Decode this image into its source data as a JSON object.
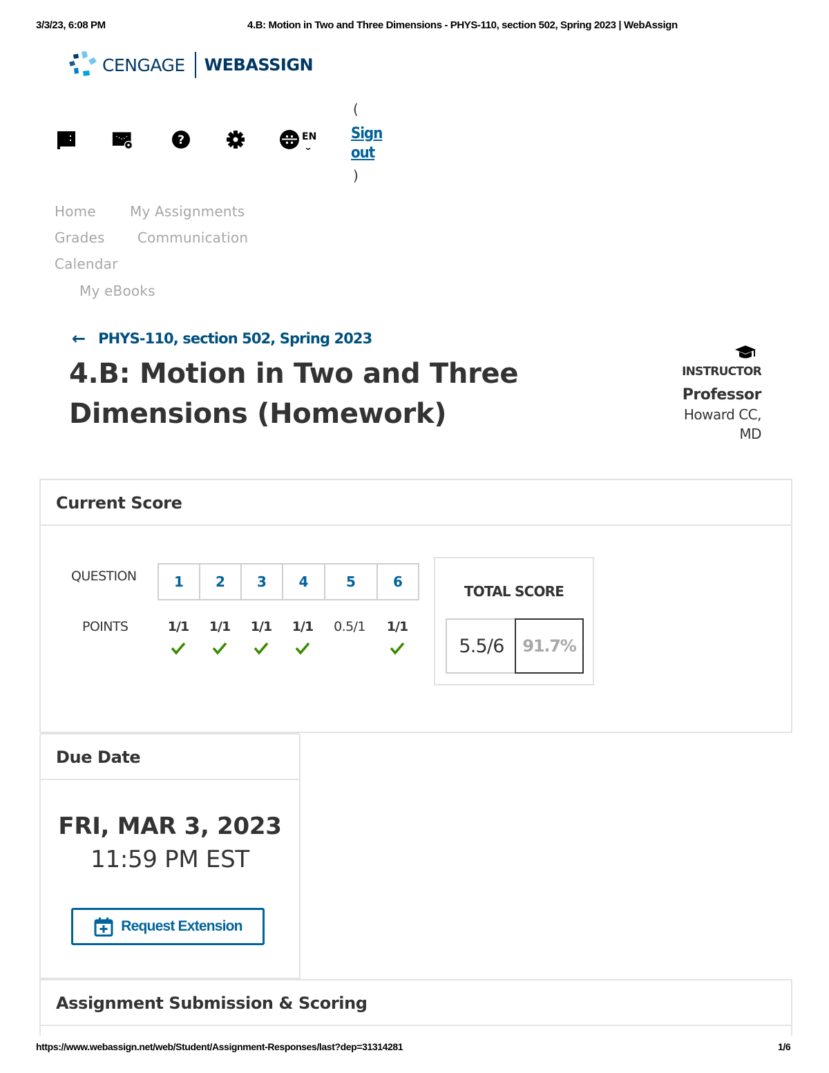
{
  "print": {
    "datetime": "3/3/23, 6:08 PM",
    "doc_title": "4.B: Motion in Two and Three Dimensions - PHYS-110, section 502, Spring 2023 | WebAssign",
    "url": "https://www.webassign.net/web/Student/Assignment-Responses/last?dep=31314281",
    "page": "1/6"
  },
  "header": {
    "logo_brand": "CENGAGE",
    "logo_product": "WEBASSIGN",
    "icons": [
      "flag-icon",
      "dashboard-settings-icon",
      "help-icon",
      "gear-icon",
      "globe-icon"
    ],
    "language": "EN",
    "signout_open": "(",
    "signout_label": "Sign out",
    "signout_close": ")"
  },
  "nav": {
    "items": [
      "Home",
      "My Assignments",
      "Grades",
      "Communication",
      "Calendar",
      "My eBooks"
    ]
  },
  "course": {
    "breadcrumb": "PHYS-110, section 502, Spring 2023",
    "assignment_title": "4.B: Motion in Two and Three Dimensions (Homework)"
  },
  "instructor": {
    "role": "INSTRUCTOR",
    "name_line1": "Professor",
    "name_line2": "Howard CC,",
    "name_line3": "MD"
  },
  "current_score": {
    "heading": "Current Score",
    "question_label": "QUESTION",
    "points_label": "POINTS",
    "questions": [
      {
        "number": "1",
        "points": "1/1",
        "correct": true
      },
      {
        "number": "2",
        "points": "1/1",
        "correct": true
      },
      {
        "number": "3",
        "points": "1/1",
        "correct": true
      },
      {
        "number": "4",
        "points": "1/1",
        "correct": true
      },
      {
        "number": "5",
        "points": "0.5/1",
        "correct": false
      },
      {
        "number": "6",
        "points": "1/1",
        "correct": true
      }
    ],
    "total_label": "TOTAL SCORE",
    "total_fraction": "5.5/6",
    "total_percent": "91.7%"
  },
  "due_date": {
    "heading": "Due Date",
    "date": "FRI, MAR 3, 2023",
    "time": "11:59 PM EST",
    "extension_label": "Request Extension"
  },
  "submission": {
    "heading": "Assignment Submission & Scoring"
  },
  "colors": {
    "brand_navy": "#003865",
    "link_blue": "#00639b",
    "check_green": "#3a8a00",
    "nav_gray": "#a6a6a6"
  }
}
